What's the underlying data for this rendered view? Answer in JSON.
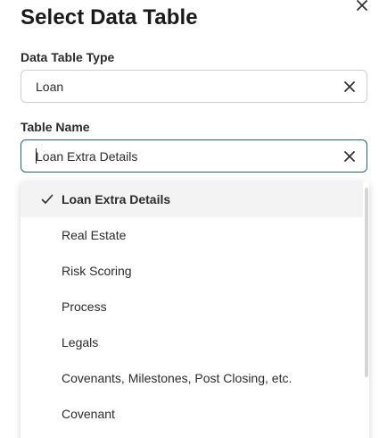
{
  "dialog": {
    "title": "Select Data Table"
  },
  "fields": {
    "type": {
      "label": "Data Table Type",
      "value": "Loan"
    },
    "name": {
      "label": "Table Name",
      "value": "Loan Extra Details"
    }
  },
  "dropdown": {
    "selected": "Loan Extra Details",
    "options": [
      {
        "label": "Loan Extra Details"
      },
      {
        "label": "Real Estate"
      },
      {
        "label": "Risk Scoring"
      },
      {
        "label": "Process"
      },
      {
        "label": "Legals"
      },
      {
        "label": "Covenants, Milestones, Post Closing, etc."
      },
      {
        "label": "Covenant"
      }
    ]
  },
  "colors": {
    "focus_border": "#1c6b6b",
    "selected_bg": "#f3f3f3"
  },
  "icons": [
    "close-icon",
    "clear-icon",
    "check-icon"
  ]
}
